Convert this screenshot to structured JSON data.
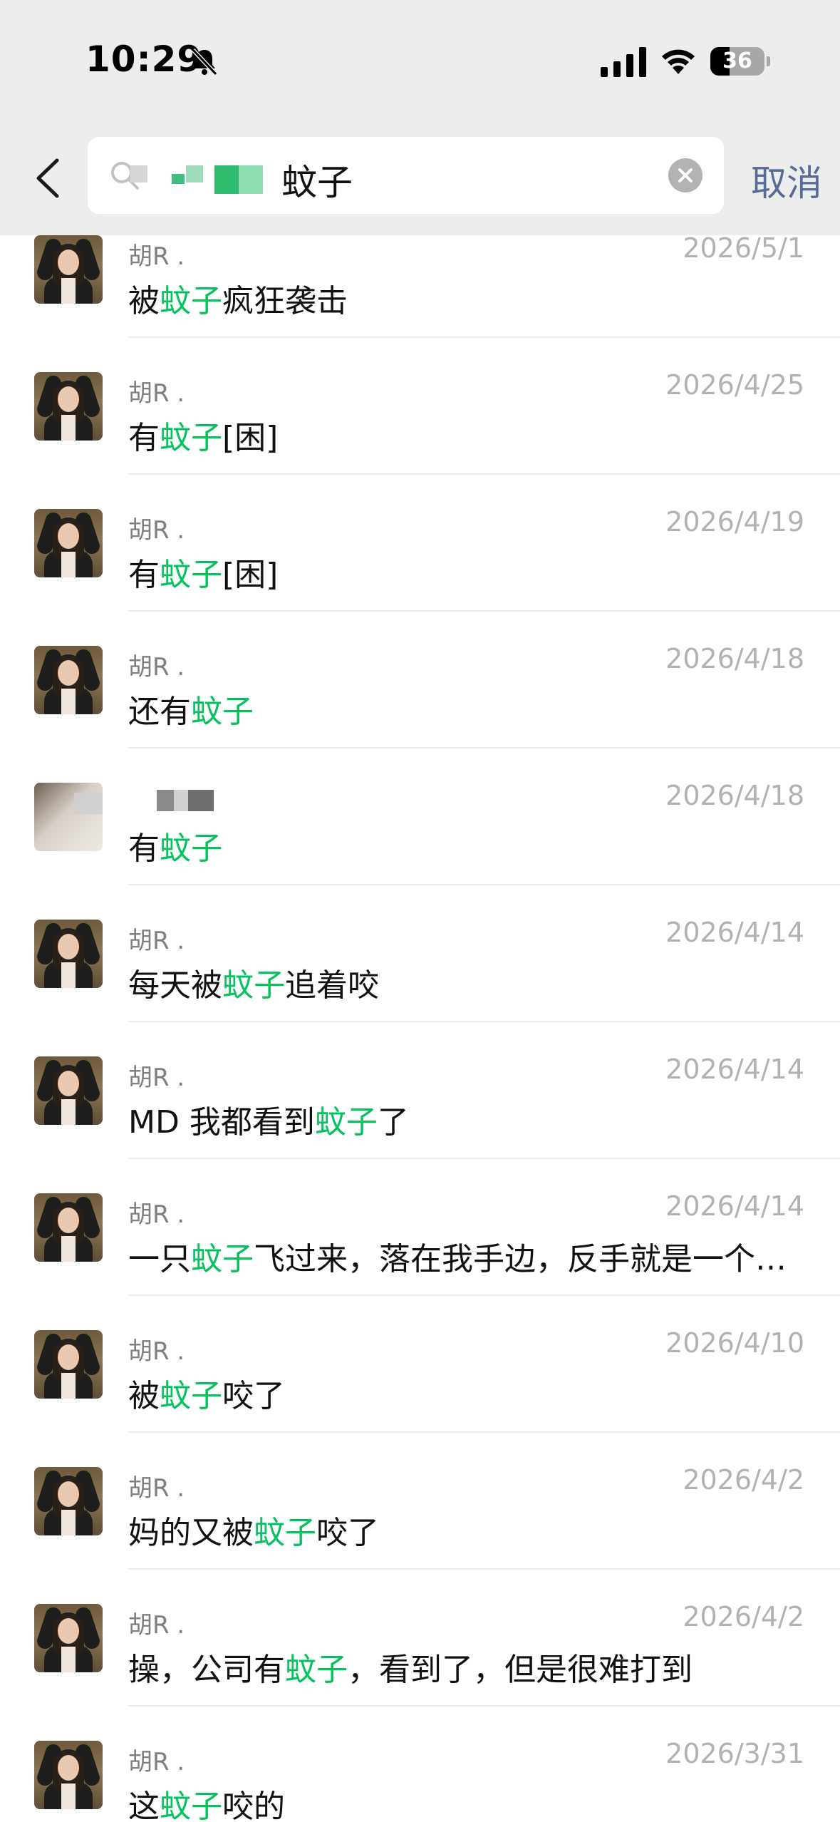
{
  "status_bar": {
    "time": "10:29",
    "battery": "36",
    "battery_level": 0.36
  },
  "search": {
    "keyword": "蚊子",
    "cancel_label": "取消"
  },
  "results": [
    {
      "sender": "胡R .",
      "date": "2026/5/1",
      "parts": [
        {
          "t": "被",
          "h": false
        },
        {
          "t": "蚊子",
          "h": true
        },
        {
          "t": "疯狂袭击",
          "h": false
        }
      ],
      "avatar": "person"
    },
    {
      "sender": "胡R .",
      "date": "2026/4/25",
      "parts": [
        {
          "t": "有",
          "h": false
        },
        {
          "t": "蚊子",
          "h": true
        },
        {
          "t": "[困]",
          "h": false
        }
      ],
      "avatar": "person"
    },
    {
      "sender": "胡R .",
      "date": "2026/4/19",
      "parts": [
        {
          "t": "有",
          "h": false
        },
        {
          "t": "蚊子",
          "h": true
        },
        {
          "t": "[困]",
          "h": false
        }
      ],
      "avatar": "person"
    },
    {
      "sender": "胡R .",
      "date": "2026/4/18",
      "parts": [
        {
          "t": "还有",
          "h": false
        },
        {
          "t": "蚊子",
          "h": true
        }
      ],
      "avatar": "person"
    },
    {
      "sender": "",
      "date": "2026/4/18",
      "parts": [
        {
          "t": "有",
          "h": false
        },
        {
          "t": "蚊子",
          "h": true
        }
      ],
      "avatar": "cat"
    },
    {
      "sender": "胡R .",
      "date": "2026/4/14",
      "parts": [
        {
          "t": "每天被",
          "h": false
        },
        {
          "t": "蚊子",
          "h": true
        },
        {
          "t": "追着咬",
          "h": false
        }
      ],
      "avatar": "person"
    },
    {
      "sender": "胡R .",
      "date": "2026/4/14",
      "parts": [
        {
          "t": "MD 我都看到",
          "h": false
        },
        {
          "t": "蚊子",
          "h": true
        },
        {
          "t": "了",
          "h": false
        }
      ],
      "avatar": "person"
    },
    {
      "sender": "胡R .",
      "date": "2026/4/14",
      "parts": [
        {
          "t": "一只",
          "h": false
        },
        {
          "t": "蚊子",
          "h": true
        },
        {
          "t": "飞过来，落在我手边，反手就是一个…",
          "h": false
        }
      ],
      "avatar": "person"
    },
    {
      "sender": "胡R .",
      "date": "2026/4/10",
      "parts": [
        {
          "t": "被",
          "h": false
        },
        {
          "t": "蚊子",
          "h": true
        },
        {
          "t": "咬了",
          "h": false
        }
      ],
      "avatar": "person"
    },
    {
      "sender": "胡R .",
      "date": "2026/4/2",
      "parts": [
        {
          "t": "妈的又被",
          "h": false
        },
        {
          "t": "蚊子",
          "h": true
        },
        {
          "t": "咬了",
          "h": false
        }
      ],
      "avatar": "person"
    },
    {
      "sender": "胡R .",
      "date": "2026/4/2",
      "parts": [
        {
          "t": "操，公司有",
          "h": false
        },
        {
          "t": "蚊子",
          "h": true
        },
        {
          "t": "，看到了，但是很难打到",
          "h": false
        }
      ],
      "avatar": "person"
    },
    {
      "sender": "胡R .",
      "date": "2026/3/31",
      "parts": [
        {
          "t": "这",
          "h": false
        },
        {
          "t": "蚊子",
          "h": true
        },
        {
          "t": "咬的",
          "h": false
        }
      ],
      "avatar": "person"
    }
  ]
}
